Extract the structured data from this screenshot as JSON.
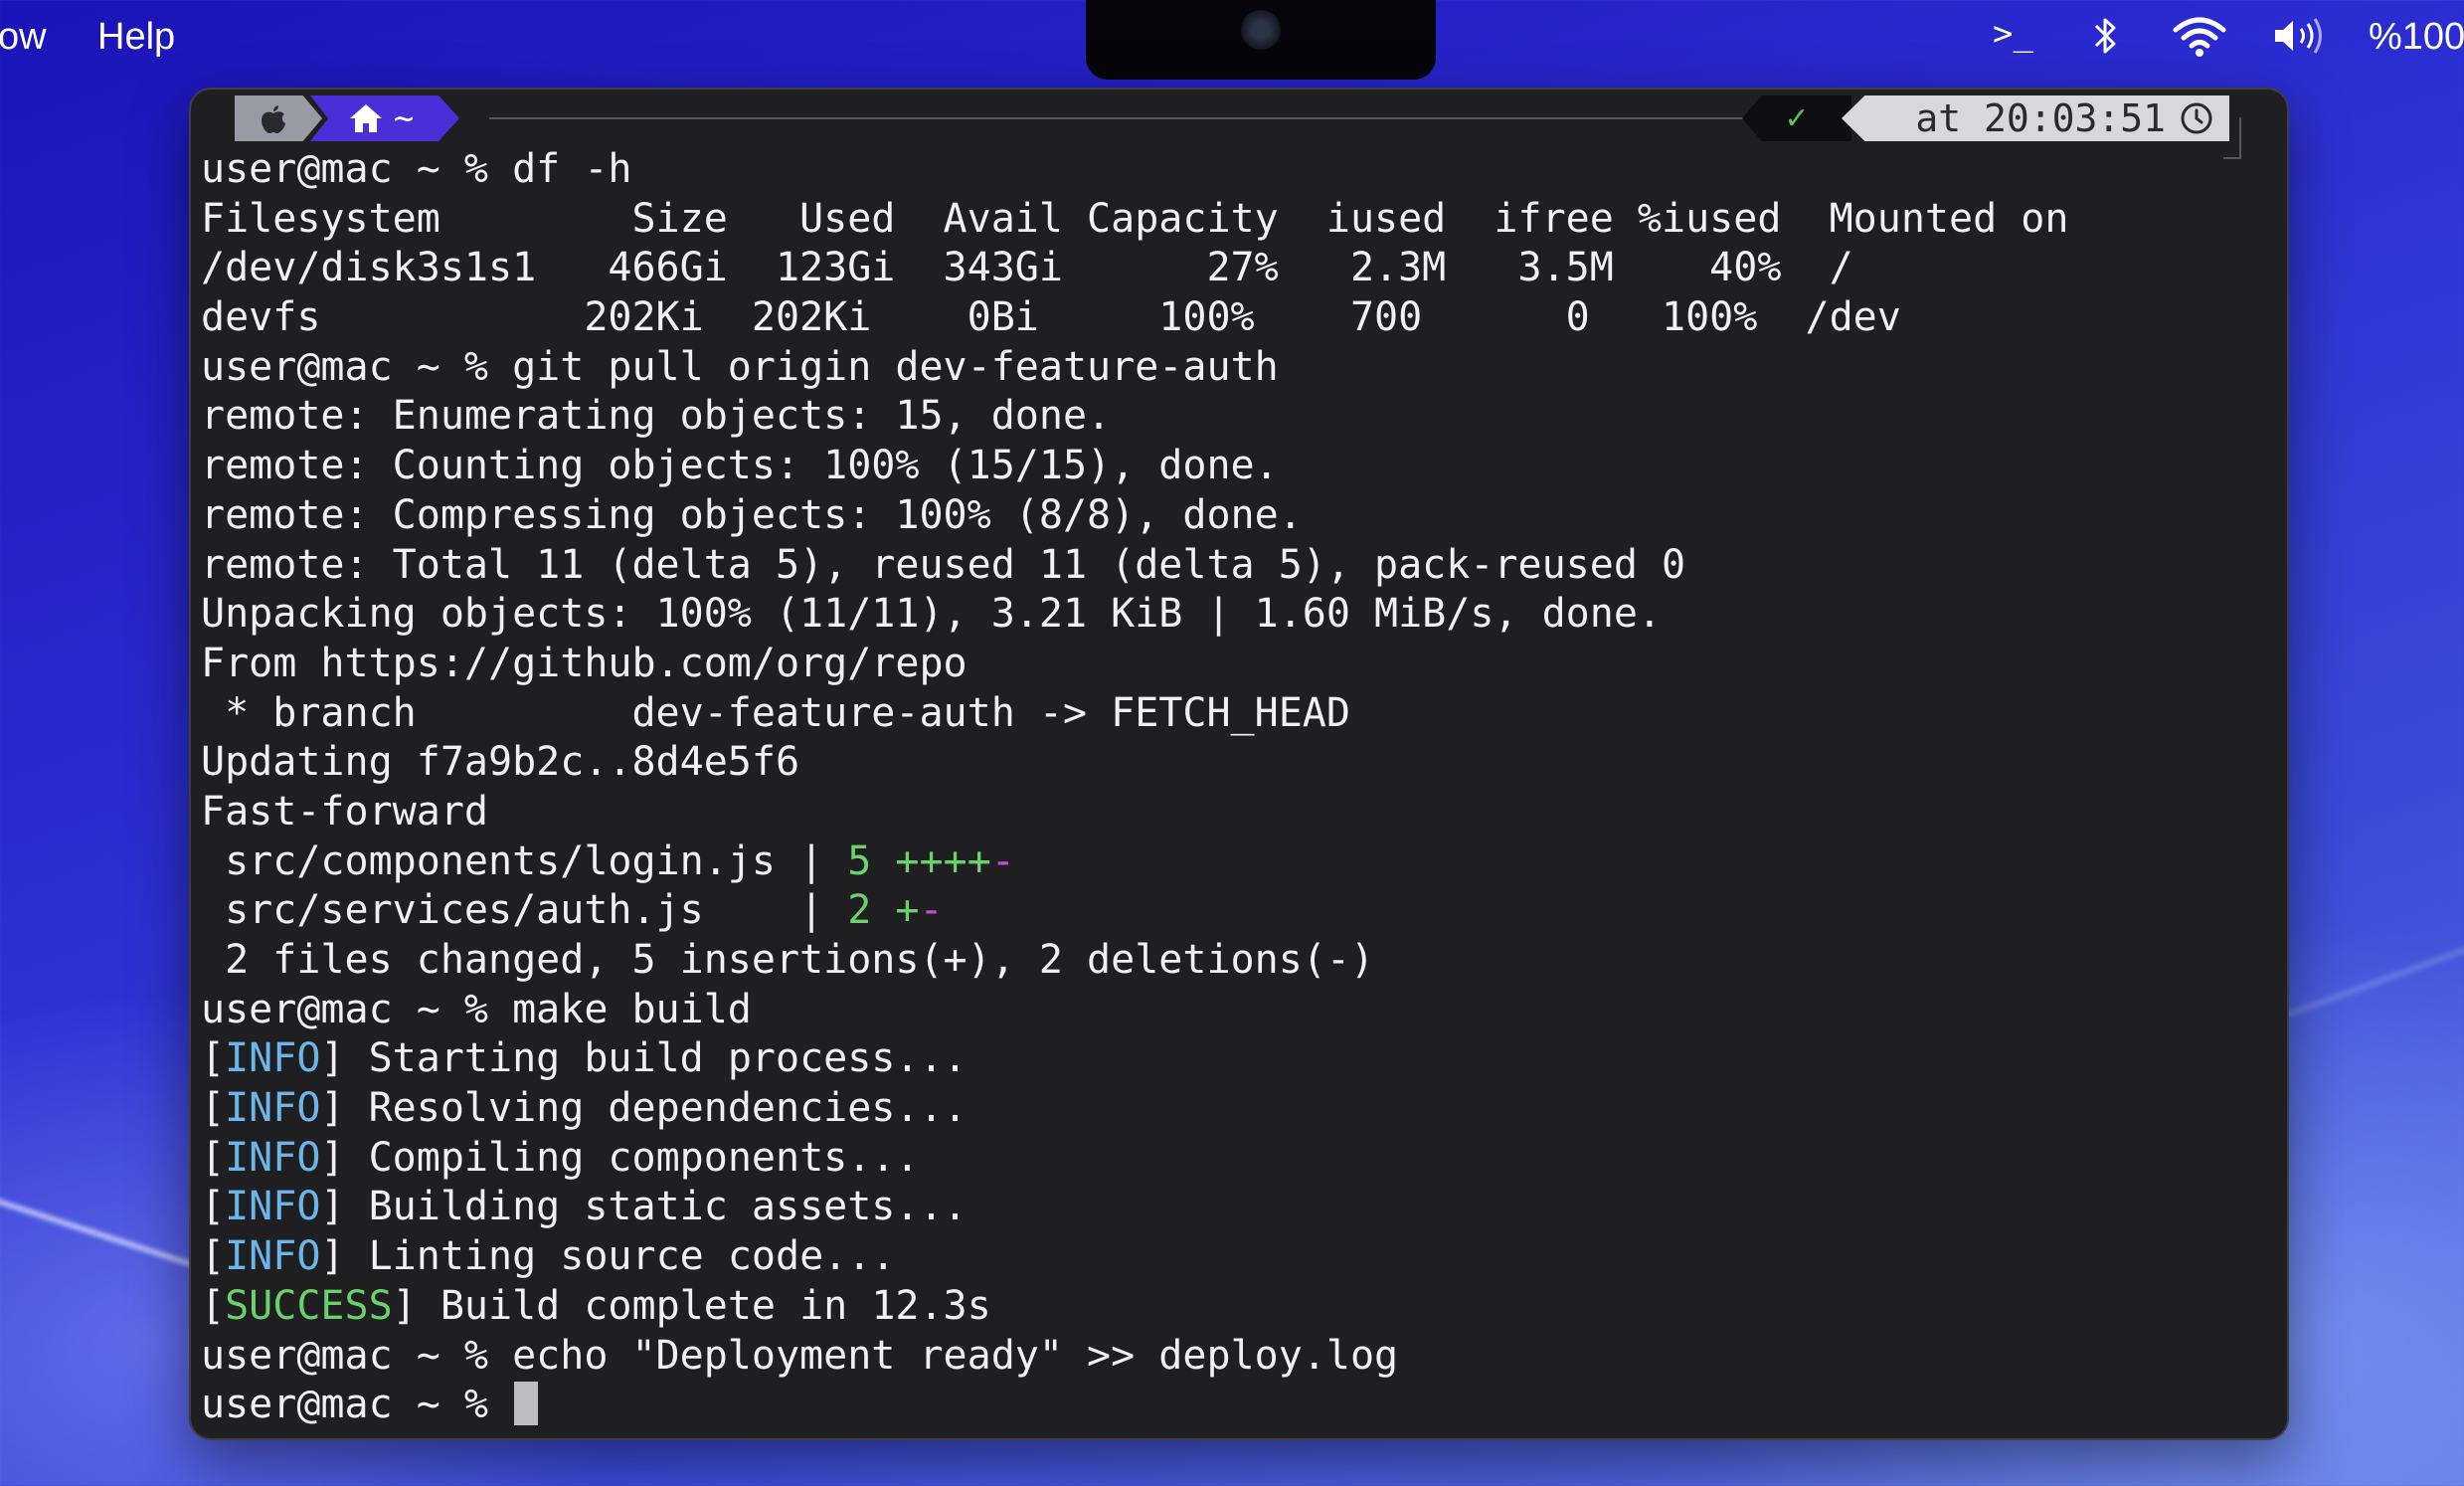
{
  "menubar": {
    "left_items": [
      "ow",
      "Help"
    ],
    "status_icons": [
      "terminal-icon",
      "bluetooth-icon",
      "wifi-icon",
      "volume-icon"
    ],
    "terminal_label": ">_",
    "battery": "%100"
  },
  "prompt_bar": {
    "path": "~",
    "status_mark": "✓",
    "time": "at 20:03:51"
  },
  "terminal": {
    "lines": [
      {
        "name": "cmd-df",
        "segments": [
          {
            "text": "user@mac ~ % df -h"
          }
        ]
      },
      {
        "name": "df-header",
        "segments": [
          {
            "text": "Filesystem        Size   Used  Avail Capacity  iused  ifree %iused  Mounted on"
          }
        ]
      },
      {
        "name": "df-row",
        "segments": [
          {
            "text": "/dev/disk3s1s1   466Gi  123Gi  343Gi      27%   2.3M   3.5M    40%  /"
          }
        ]
      },
      {
        "name": "df-row",
        "segments": [
          {
            "text": "devfs           202Ki  202Ki    0Bi     100%    700      0   100%  /dev"
          }
        ]
      },
      {
        "name": "cmd-git-pull",
        "segments": [
          {
            "text": "user@mac ~ % git pull origin dev-feature-auth"
          }
        ]
      },
      {
        "name": "output-line",
        "segments": [
          {
            "text": "remote: Enumerating objects: 15, done."
          }
        ]
      },
      {
        "name": "output-line",
        "segments": [
          {
            "text": "remote: Counting objects: 100% (15/15), done."
          }
        ]
      },
      {
        "name": "output-line",
        "segments": [
          {
            "text": "remote: Compressing objects: 100% (8/8), done."
          }
        ]
      },
      {
        "name": "output-line",
        "segments": [
          {
            "text": "remote: Total 11 (delta 5), reused 11 (delta 5), pack-reused 0"
          }
        ]
      },
      {
        "name": "output-line",
        "segments": [
          {
            "text": "Unpacking objects: 100% (11/11), 3.21 KiB | 1.60 MiB/s, done."
          }
        ]
      },
      {
        "name": "output-line",
        "segments": [
          {
            "text": "From https://github.com/org/repo"
          }
        ]
      },
      {
        "name": "output-line",
        "segments": [
          {
            "text": " * branch         dev-feature-auth -> FETCH_HEAD"
          }
        ]
      },
      {
        "name": "output-line",
        "segments": [
          {
            "text": "Updating f7a9b2c..8d4e5f6"
          }
        ]
      },
      {
        "name": "output-line",
        "segments": [
          {
            "text": "Fast-forward"
          }
        ]
      },
      {
        "name": "diffstat-line",
        "segments": [
          {
            "text": " src/components/login.js | "
          },
          {
            "text": "5 ++++",
            "cls": "c-green"
          },
          {
            "text": "-",
            "cls": "c-purple"
          }
        ]
      },
      {
        "name": "diffstat-line",
        "segments": [
          {
            "text": " src/services/auth.js    | "
          },
          {
            "text": "2 +",
            "cls": "c-green"
          },
          {
            "text": "-",
            "cls": "c-purple"
          }
        ]
      },
      {
        "name": "output-line",
        "segments": [
          {
            "text": " 2 files changed, 5 insertions(+), 2 deletions(-)"
          }
        ]
      },
      {
        "name": "cmd-make",
        "segments": [
          {
            "text": "user@mac ~ % make build"
          }
        ]
      },
      {
        "name": "log-line",
        "segments": [
          {
            "text": "["
          },
          {
            "text": "INFO",
            "cls": "c-blue"
          },
          {
            "text": "] Starting build process..."
          }
        ]
      },
      {
        "name": "log-line",
        "segments": [
          {
            "text": "["
          },
          {
            "text": "INFO",
            "cls": "c-blue"
          },
          {
            "text": "] Resolving dependencies..."
          }
        ]
      },
      {
        "name": "log-line",
        "segments": [
          {
            "text": "["
          },
          {
            "text": "INFO",
            "cls": "c-blue"
          },
          {
            "text": "] Compiling components..."
          }
        ]
      },
      {
        "name": "log-line",
        "segments": [
          {
            "text": "["
          },
          {
            "text": "INFO",
            "cls": "c-blue"
          },
          {
            "text": "] Building static assets..."
          }
        ]
      },
      {
        "name": "log-line",
        "segments": [
          {
            "text": "["
          },
          {
            "text": "INFO",
            "cls": "c-blue"
          },
          {
            "text": "] Linting source code..."
          }
        ]
      },
      {
        "name": "log-line",
        "segments": [
          {
            "text": "["
          },
          {
            "text": "SUCCESS",
            "cls": "c-green"
          },
          {
            "text": "] Build complete in 12.3s"
          }
        ]
      },
      {
        "name": "cmd-echo",
        "segments": [
          {
            "text": "user@mac ~ % echo \"Deployment ready\" >> deploy.log"
          }
        ]
      },
      {
        "name": "current-prompt",
        "segments": [
          {
            "text": "user@mac ~ % "
          }
        ],
        "cursor": true
      }
    ]
  }
}
